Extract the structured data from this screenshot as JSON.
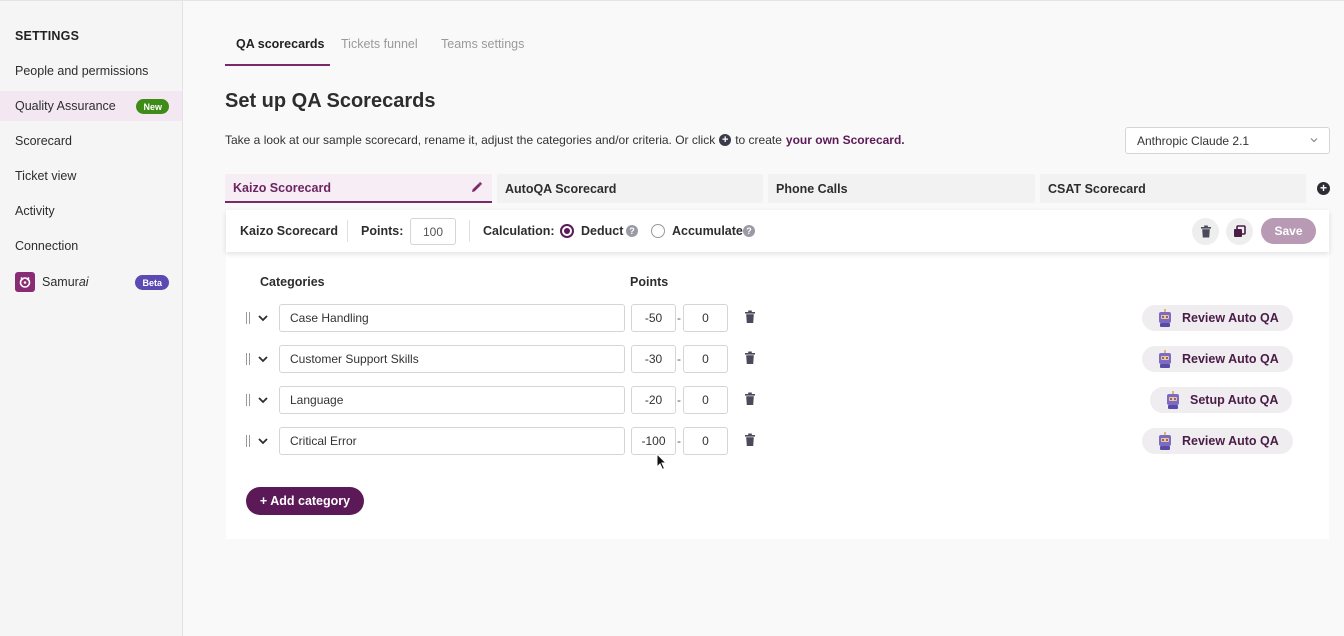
{
  "sidebar": {
    "title": "SETTINGS",
    "items": [
      {
        "label": "People and permissions"
      },
      {
        "label": "Quality Assurance",
        "badge": "New"
      },
      {
        "label": "Scorecard"
      },
      {
        "label": "Ticket view"
      },
      {
        "label": "Activity"
      },
      {
        "label": "Connection"
      },
      {
        "label_pre": "Samur",
        "label_em": "ai",
        "badge": "Beta"
      }
    ]
  },
  "top_tabs": [
    "QA scorecards",
    "Tickets funnel",
    "Teams settings"
  ],
  "page": {
    "title": "Set up QA Scorecards",
    "intro_pre": "Take a look at our sample scorecard, rename it, adjust the categories and/or criteria. Or click",
    "intro_mid": "to create",
    "intro_link": "your own Scorecard.",
    "model_select": "Anthropic Claude 2.1"
  },
  "scorecard_tabs": [
    "Kaizo Scorecard",
    "AutoQA Scorecard",
    "Phone Calls",
    "CSAT Scorecard"
  ],
  "editor": {
    "name": "Kaizo Scorecard",
    "points_label": "Points:",
    "points_value": "100",
    "calc_label": "Calculation:",
    "deduct_label": "Deduct",
    "accumulate_label": "Accumulate",
    "save_label": "Save",
    "col_categories": "Categories",
    "col_points": "Points",
    "add_category_label": "+ Add category"
  },
  "categories": [
    {
      "name": "Case Handling",
      "min": "-50",
      "max": "0",
      "action": "Review Auto QA"
    },
    {
      "name": "Customer Support Skills",
      "min": "-30",
      "max": "0",
      "action": "Review Auto QA"
    },
    {
      "name": "Language",
      "min": "-20",
      "max": "0",
      "action": "Setup Auto QA"
    },
    {
      "name": "Critical Error",
      "min": "-100",
      "max": "0",
      "action": "Review Auto QA"
    }
  ],
  "colors": {
    "brand": "#5b1a57",
    "accent": "#7a2a6a",
    "new_badge": "#3e8c17",
    "beta_badge": "#5b4ab1"
  }
}
